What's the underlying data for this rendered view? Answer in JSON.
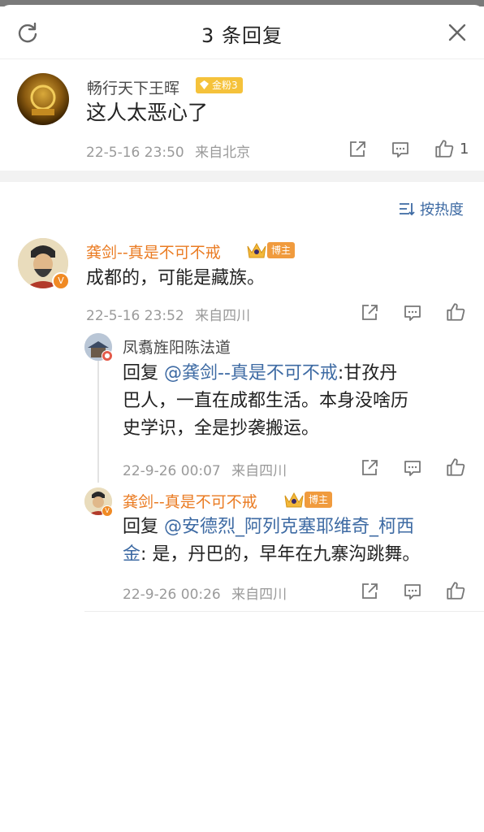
{
  "header": {
    "title": "3 条回复"
  },
  "main_comment": {
    "author": "畅行天下王晖",
    "badge": "金粉3",
    "text": "这人太恶心了",
    "time": "22-5-16 23:50",
    "location": "来自北京",
    "likes": "1"
  },
  "sort": {
    "label": "按热度"
  },
  "replies": [
    {
      "author": "龚剑--真是不可不戒",
      "badge": "博主",
      "text": "成都的，可能是藏族。",
      "time": "22-5-16 23:52",
      "location": "来自四川"
    },
    {
      "author": "凤翥旌阳陈法道",
      "prefix": "回复 ",
      "mention": "@龚剑--真是不可不戒",
      "line1_rest": ":甘孜丹",
      "line2": "巴人，一直在成都生活。本身没啥历",
      "line3": "史学识，全是抄袭搬运。",
      "time": "22-9-26 00:07",
      "location": "来自四川"
    },
    {
      "author": "龚剑--真是不可不戒",
      "badge": "博主",
      "prefix": "回复 ",
      "mention_line1": "@安德烈_阿列克塞耶维奇_柯西",
      "mention_line2": "金",
      "line2_rest": ": 是，丹巴的，早年在九寨沟跳舞。",
      "time": "22-9-26 00:26",
      "location": "来自四川"
    }
  ],
  "colors": {
    "accent_orange": "#ea7b22",
    "link_blue": "#3d6aa3",
    "meta_gray": "#9a9a9a"
  },
  "icons": [
    "refresh-icon",
    "close-icon",
    "share-icon",
    "comment-icon",
    "like-icon",
    "sort-icon",
    "crown-icon",
    "verified-icon"
  ]
}
